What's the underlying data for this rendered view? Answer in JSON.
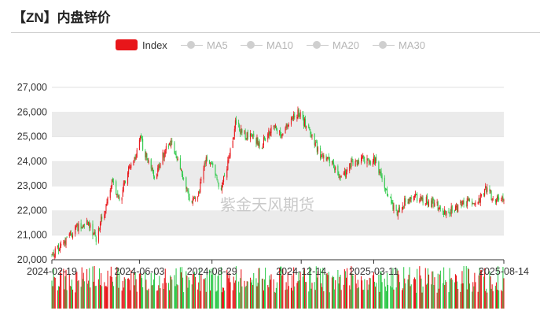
{
  "header": {
    "title": "【ZN】内盘锌价"
  },
  "legend": [
    {
      "label": "Index",
      "active": true
    },
    {
      "label": "MA5",
      "active": false
    },
    {
      "label": "MA10",
      "active": false
    },
    {
      "label": "MA20",
      "active": false
    },
    {
      "label": "MA30",
      "active": false
    }
  ],
  "watermark": "紫金天风期货",
  "colors": {
    "up": "#e8161a",
    "down": "#2ec94a",
    "band": "#ebebeb"
  },
  "chart_data": {
    "type": "candlestick",
    "title": "【ZN】内盘锌价",
    "xlabel": "",
    "ylabel": "",
    "ylim": [
      20000,
      27000
    ],
    "y_ticks": [
      20000,
      21000,
      22000,
      23000,
      24000,
      25000,
      26000,
      27000
    ],
    "y_tick_labels": [
      "20,000",
      "21,000",
      "22,000",
      "23,000",
      "24,000",
      "25,000",
      "26,000",
      "27,000"
    ],
    "x_tick_labels": [
      "2024-02-19",
      "2024-06-03",
      "2024-08-29",
      "2024-12-14",
      "2025-03-11",
      "2025-08-14"
    ],
    "x_range": [
      "2024-02-19",
      "2025-08-14"
    ],
    "grid": "alternating horizontal bands",
    "legend_position": "top-center",
    "series": [
      {
        "name": "Index",
        "type": "candlestick"
      }
    ],
    "close_path": [
      [
        "2024-02-19",
        20200
      ],
      [
        "2024-03-06",
        20700
      ],
      [
        "2024-03-20",
        21300
      ],
      [
        "2024-04-01",
        21500
      ],
      [
        "2024-04-12",
        20900
      ],
      [
        "2024-04-22",
        22000
      ],
      [
        "2024-05-01",
        23200
      ],
      [
        "2024-05-10",
        22300
      ],
      [
        "2024-05-20",
        23600
      ],
      [
        "2024-05-28",
        24000
      ],
      [
        "2024-06-03",
        25000
      ],
      [
        "2024-06-12",
        24100
      ],
      [
        "2024-06-22",
        23300
      ],
      [
        "2024-07-01",
        24200
      ],
      [
        "2024-07-10",
        24800
      ],
      [
        "2024-07-20",
        24000
      ],
      [
        "2024-07-28",
        23000
      ],
      [
        "2024-08-05",
        22300
      ],
      [
        "2024-08-12",
        22500
      ],
      [
        "2024-08-22",
        24100
      ],
      [
        "2024-08-29",
        23800
      ],
      [
        "2024-09-08",
        22700
      ],
      [
        "2024-09-18",
        24000
      ],
      [
        "2024-09-26",
        25500
      ],
      [
        "2024-10-06",
        25100
      ],
      [
        "2024-10-16",
        25000
      ],
      [
        "2024-10-28",
        24700
      ],
      [
        "2024-11-10",
        25400
      ],
      [
        "2024-11-20",
        25100
      ],
      [
        "2024-11-30",
        25700
      ],
      [
        "2024-12-08",
        26000
      ],
      [
        "2024-12-14",
        25800
      ],
      [
        "2024-12-24",
        25200
      ],
      [
        "2025-01-05",
        24300
      ],
      [
        "2025-01-18",
        24000
      ],
      [
        "2025-02-01",
        23300
      ],
      [
        "2025-02-12",
        23900
      ],
      [
        "2025-02-24",
        24100
      ],
      [
        "2025-03-05",
        24000
      ],
      [
        "2025-03-11",
        24100
      ],
      [
        "2025-03-20",
        23400
      ],
      [
        "2025-03-28",
        22700
      ],
      [
        "2025-04-06",
        21900
      ],
      [
        "2025-04-15",
        22300
      ],
      [
        "2025-04-28",
        22600
      ],
      [
        "2025-05-10",
        22400
      ],
      [
        "2025-05-22",
        22300
      ],
      [
        "2025-06-05",
        21900
      ],
      [
        "2025-06-18",
        22100
      ],
      [
        "2025-07-01",
        22400
      ],
      [
        "2025-07-12",
        22200
      ],
      [
        "2025-07-24",
        22900
      ],
      [
        "2025-08-01",
        22500
      ],
      [
        "2025-08-08",
        22400
      ],
      [
        "2025-08-14",
        22600
      ]
    ]
  }
}
